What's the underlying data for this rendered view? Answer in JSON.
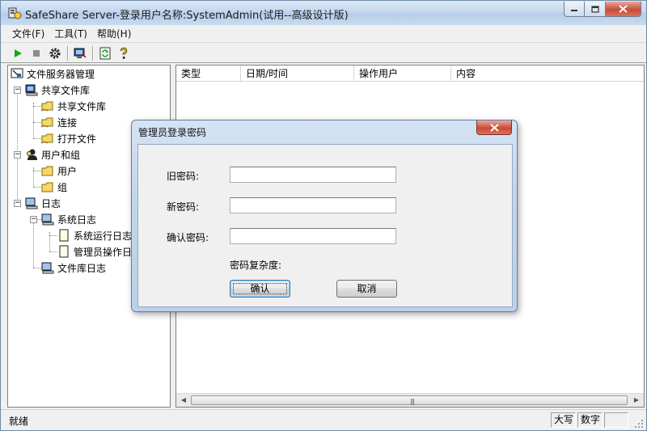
{
  "window": {
    "title": "SafeShare Server-登录用户名称:SystemAdmin(试用--高级设计版)",
    "controls": [
      "minimize",
      "maximize",
      "close"
    ]
  },
  "menu": {
    "items": [
      {
        "label": "文件(F)"
      },
      {
        "label": "工具(T)"
      },
      {
        "label": "帮助(H)"
      }
    ]
  },
  "toolbar": {
    "buttons": [
      "play-icon",
      "stop-icon",
      "settings-gear-icon",
      "server-connect-icon",
      "refresh-icon",
      "help-icon"
    ]
  },
  "tree": {
    "root": "文件服务器管理",
    "share_group": "共享文件库",
    "share_lib": "共享文件库",
    "connections": "连接",
    "open_files": "打开文件",
    "users_groups": "用户和组",
    "users": "用户",
    "groups": "组",
    "logs": "日志",
    "system_log": "系统日志",
    "run_log": "系统运行日志",
    "admin_log": "管理员操作日志",
    "lib_log": "文件库日志"
  },
  "list": {
    "columns": [
      "类型",
      "日期/时间",
      "操作用户",
      "内容"
    ],
    "rows": []
  },
  "status": {
    "text": "就绪",
    "caps": "大写",
    "num": "数字",
    "scrl": ""
  },
  "dialog": {
    "title": "管理员登录密码",
    "old_password_label": "旧密码:",
    "new_password_label": "新密码:",
    "confirm_password_label": "确认密码:",
    "old_password_value": "",
    "new_password_value": "",
    "confirm_password_value": "",
    "complexity_label": "密码复杂度:",
    "ok_label": "确认",
    "cancel_label": "取消"
  }
}
